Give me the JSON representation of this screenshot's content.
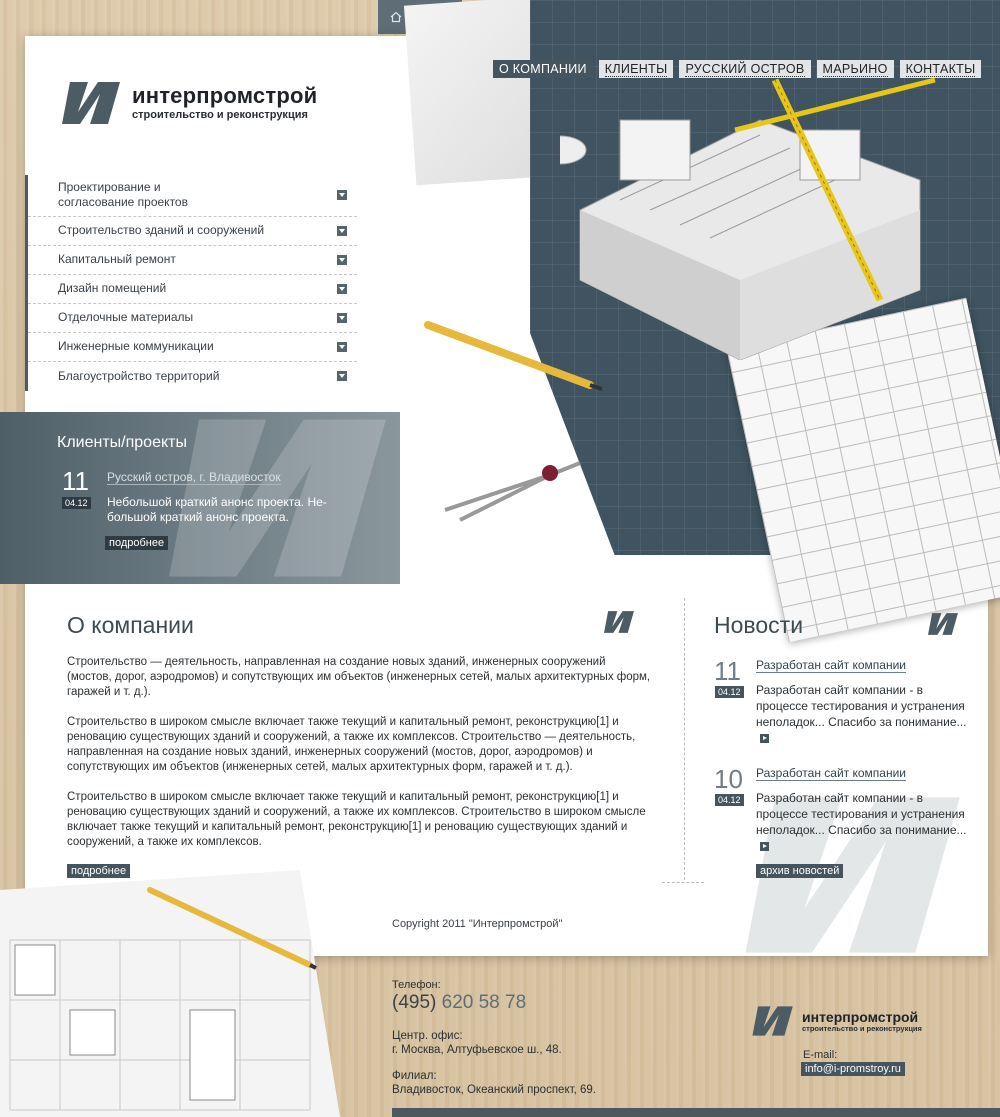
{
  "topbar": {
    "icons": [
      "home-icon",
      "sitemap-icon",
      "mail-icon"
    ]
  },
  "nav": [
    {
      "label": "О компании",
      "active": true
    },
    {
      "label": "Клиенты",
      "active": false
    },
    {
      "label": "Русский остров",
      "active": false
    },
    {
      "label": "Марьино",
      "active": false
    },
    {
      "label": "Контакты",
      "active": false
    }
  ],
  "logo": {
    "name": "интерпромстрой",
    "tagline": "строительство и реконструкция"
  },
  "menu": [
    {
      "label": "Проектирование и\nсогласование проектов"
    },
    {
      "label": "Строительство зданий и сооружений"
    },
    {
      "label": "Капитальный ремонт"
    },
    {
      "label": "Дизайн помещений"
    },
    {
      "label": "Отделочные материалы"
    },
    {
      "label": "Инженерные коммуникации"
    },
    {
      "label": "Благоустройство территорий"
    }
  ],
  "clients": {
    "title": "Клиенты/проекты",
    "day": "11",
    "month": "04.12",
    "project_title": "Русский остров, г. Владивосток",
    "text": "Небольшой краткий анонс проекта. Не-большой краткий анонс проекта.",
    "more": "подробнее"
  },
  "about": {
    "title": "О компании",
    "paragraphs": [
      "Строительство — деятельность, направленная на создание новых зданий, инженерных сооружений (мостов, дорог, аэродромов) и сопутствующих им объектов (инженерных сетей, малых архитектурных форм, гаражей и т. д.).",
      "Строительство в широком смысле включает также текущий и капитальный ремонт, реконструкцию[1] и реновацию существующих зданий и сооружений, а также их комплексов. Строительство — деятельность, направленная на создание новых зданий, инженерных сооружений (мостов, дорог, аэродромов) и сопутствующих им объектов (инженерных сетей, малых архитектурных форм, гаражей и т. д.).",
      "Строительство в широком смысле включает также текущий и капитальный ремонт, реконструкцию[1] и реновацию существующих зданий и сооружений, а также их комплексов. Строительство в широком смысле включает также текущий и капитальный ремонт, реконструкцию[1] и реновацию существующих зданий и сооружений, а также их комплексов."
    ],
    "more": "подробнее"
  },
  "news": {
    "title": "Новости",
    "items": [
      {
        "day": "11",
        "month": "04.12",
        "title": "Разработан сайт компании",
        "text": "Разработан сайт компании - в процессе тестирования и устранения неполадок... Спасибо за понимание..."
      },
      {
        "day": "10",
        "month": "04.12",
        "title": "Разработан сайт компании",
        "text": "Разработан сайт компании - в процессе тестирования и устранения неполадок... Спасибо за понимание..."
      }
    ],
    "archive": "архив новостей"
  },
  "copyright": "Copyright 2011 \"Интерпромстрой\"",
  "footer": {
    "phone_label": "Телефон:",
    "phone_code": "(495)",
    "phone_number": "620 58 78",
    "office_label": "Центр. офис:",
    "office_address": "г. Москва, Алтуфьевское ш., 48.",
    "branch_label": "Филиал:",
    "branch_address": "Владивосток, Океанский проспект, 69.",
    "email_label": "E-mail:",
    "email": "info@i-promstroy.ru"
  },
  "colors": {
    "accent": "#45545d",
    "panel": "#5f6d76",
    "wood": "#d8c3a1"
  }
}
